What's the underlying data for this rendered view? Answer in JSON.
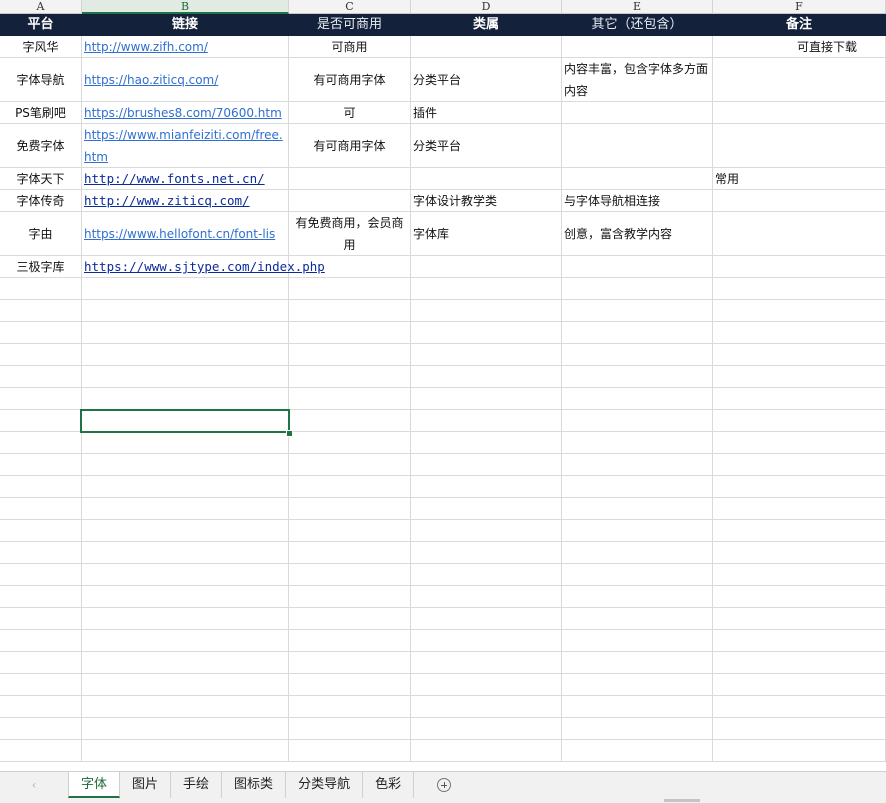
{
  "columns": [
    "A",
    "B",
    "C",
    "D",
    "E",
    "F"
  ],
  "header": {
    "a": "平台",
    "b": "链接",
    "c": "是否可商用",
    "d": "类属",
    "e": "其它（还包含）",
    "f": "备注"
  },
  "rows": [
    {
      "a": "字风华",
      "b": "http://www.zifh.com/",
      "c": "可商用",
      "d": "",
      "e": "",
      "f": "可直接下载"
    },
    {
      "a": "字体导航",
      "b": "https://hao.ziticq.com/",
      "c": "有可商用字体",
      "d": "分类平台",
      "e": "内容丰富，包含字体多方面内容",
      "f": ""
    },
    {
      "a": "PS笔刷吧",
      "b": "https://brushes8.com/70600.htm",
      "c": "可",
      "d": "插件",
      "e": "",
      "f": ""
    },
    {
      "a": "免费字体",
      "b": "https://www.mianfeiziti.com/free.htm",
      "c": "有可商用字体",
      "d": "分类平台",
      "e": "",
      "f": ""
    },
    {
      "a": "字体天下",
      "b": "http://www.fonts.net.cn/",
      "c": "",
      "d": "",
      "e": "",
      "f": "常用"
    },
    {
      "a": "字体传奇",
      "b": "http://www.ziticq.com/",
      "c": "",
      "d": "字体设计教学类",
      "e": "与字体导航相连接",
      "f": ""
    },
    {
      "a": "字由",
      "b": "https://www.hellofont.cn/font-lis",
      "c": "有免费商用，会员商用",
      "d": "字体库",
      "e": "创意，富含教学内容",
      "f": ""
    },
    {
      "a": "三极字库",
      "b": "https://www.sjtype.com/index.php",
      "c": "",
      "d": "",
      "e": "",
      "f": ""
    }
  ],
  "sheet_tabs": [
    "字体",
    "图片",
    "手绘",
    "图标类",
    "分类导航",
    "色彩"
  ],
  "active_tab": "字体",
  "nav_left_icon": "chevron-left-icon",
  "add_sheet_icon": "plus-circle-icon",
  "colors": {
    "header_bg": "#13213b",
    "accent": "#217346",
    "link": "#2f6fd0"
  }
}
